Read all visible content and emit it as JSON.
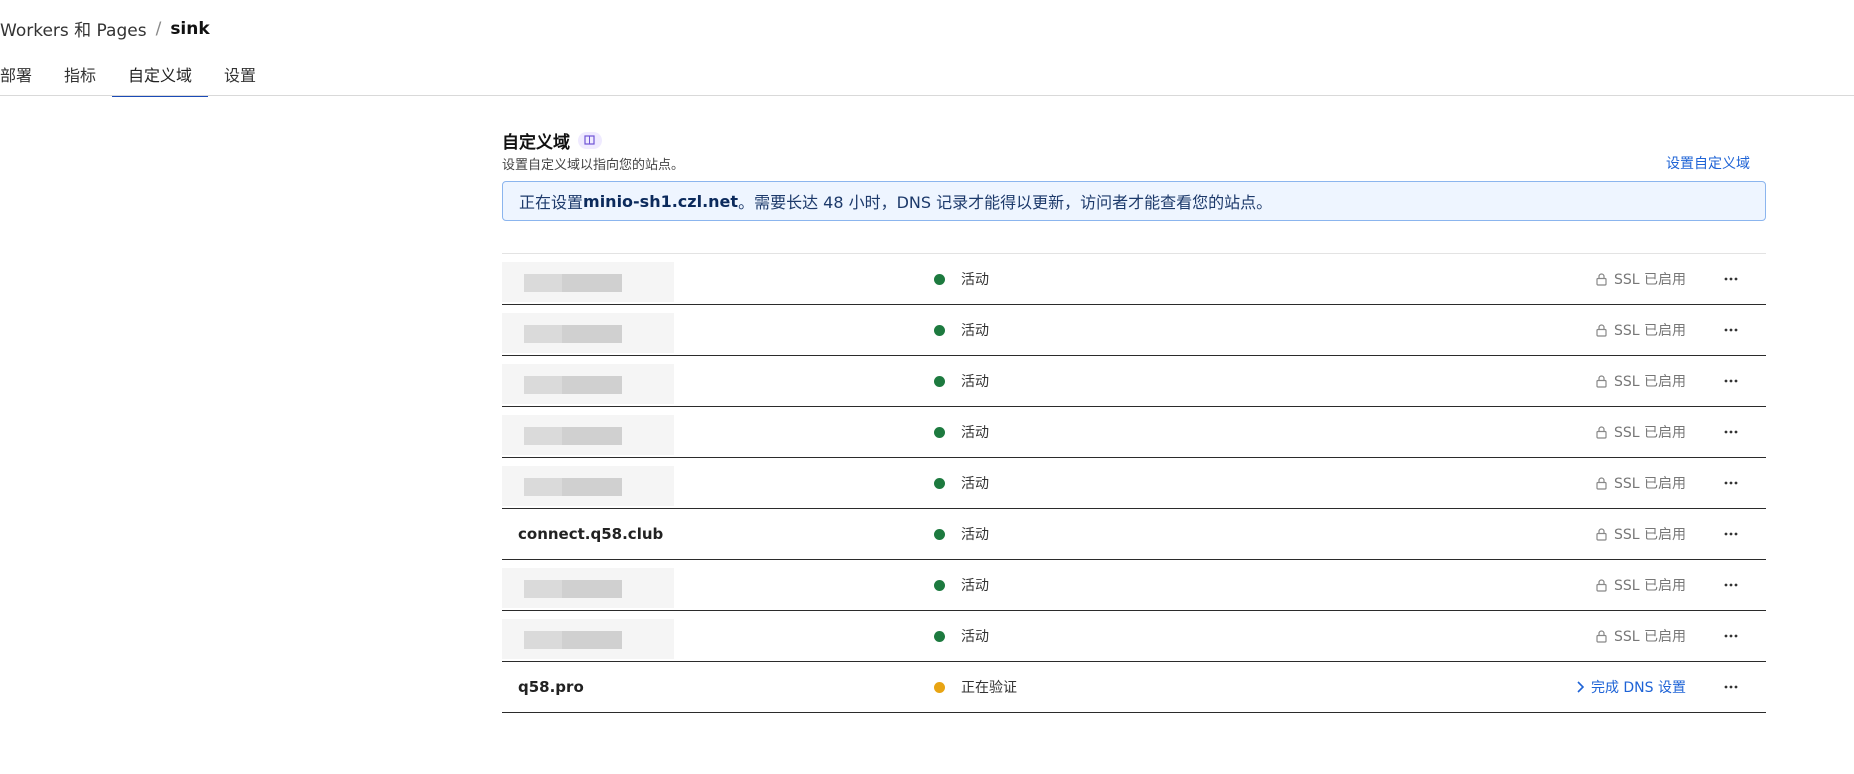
{
  "breadcrumb": {
    "parent": "Workers 和 Pages",
    "separator": "/",
    "current": "sink"
  },
  "tabs": [
    {
      "label": "部署",
      "active": false
    },
    {
      "label": "指标",
      "active": false
    },
    {
      "label": "自定义域",
      "active": true
    },
    {
      "label": "设置",
      "active": false
    }
  ],
  "section": {
    "title": "自定义域",
    "subtitle": "设置自定义域以指向您的站点。",
    "action_link": "设置自定义域"
  },
  "notice": {
    "prefix": "正在设置 ",
    "domain": "minio-sh1.czl.net",
    "suffix": "。需要长达 48 小时，DNS 记录才能得以更新，访问者才能查看您的站点。"
  },
  "domains": [
    {
      "domain": "",
      "redacted": true,
      "status": "活动",
      "status_color": "#1d7a3f",
      "ssl": "SSL 已启用"
    },
    {
      "domain": "",
      "redacted": true,
      "status": "活动",
      "status_color": "#1d7a3f",
      "ssl": "SSL 已启用"
    },
    {
      "domain": "",
      "redacted": true,
      "status": "活动",
      "status_color": "#1d7a3f",
      "ssl": "SSL 已启用"
    },
    {
      "domain": "",
      "redacted": true,
      "status": "活动",
      "status_color": "#1d7a3f",
      "ssl": "SSL 已启用"
    },
    {
      "domain": "",
      "redacted": true,
      "status": "活动",
      "status_color": "#1d7a3f",
      "ssl": "SSL 已启用"
    },
    {
      "domain": "connect.q58.club",
      "redacted": false,
      "status": "活动",
      "status_color": "#1d7a3f",
      "ssl": "SSL 已启用"
    },
    {
      "domain": "",
      "redacted": true,
      "status": "活动",
      "status_color": "#1d7a3f",
      "ssl": "SSL 已启用"
    },
    {
      "domain": "",
      "redacted": true,
      "status": "活动",
      "status_color": "#1d7a3f",
      "ssl": "SSL 已启用"
    },
    {
      "domain": "q58.pro",
      "redacted": false,
      "status": "正在验证",
      "status_color": "#e8a413",
      "ssl": "完成 DNS 设置",
      "ssl_is_link": true
    }
  ],
  "icons": {
    "more": "more-horizontal-icon",
    "lock": "lock-icon",
    "chevron": "chevron-right-icon",
    "doc": "docs-icon"
  }
}
